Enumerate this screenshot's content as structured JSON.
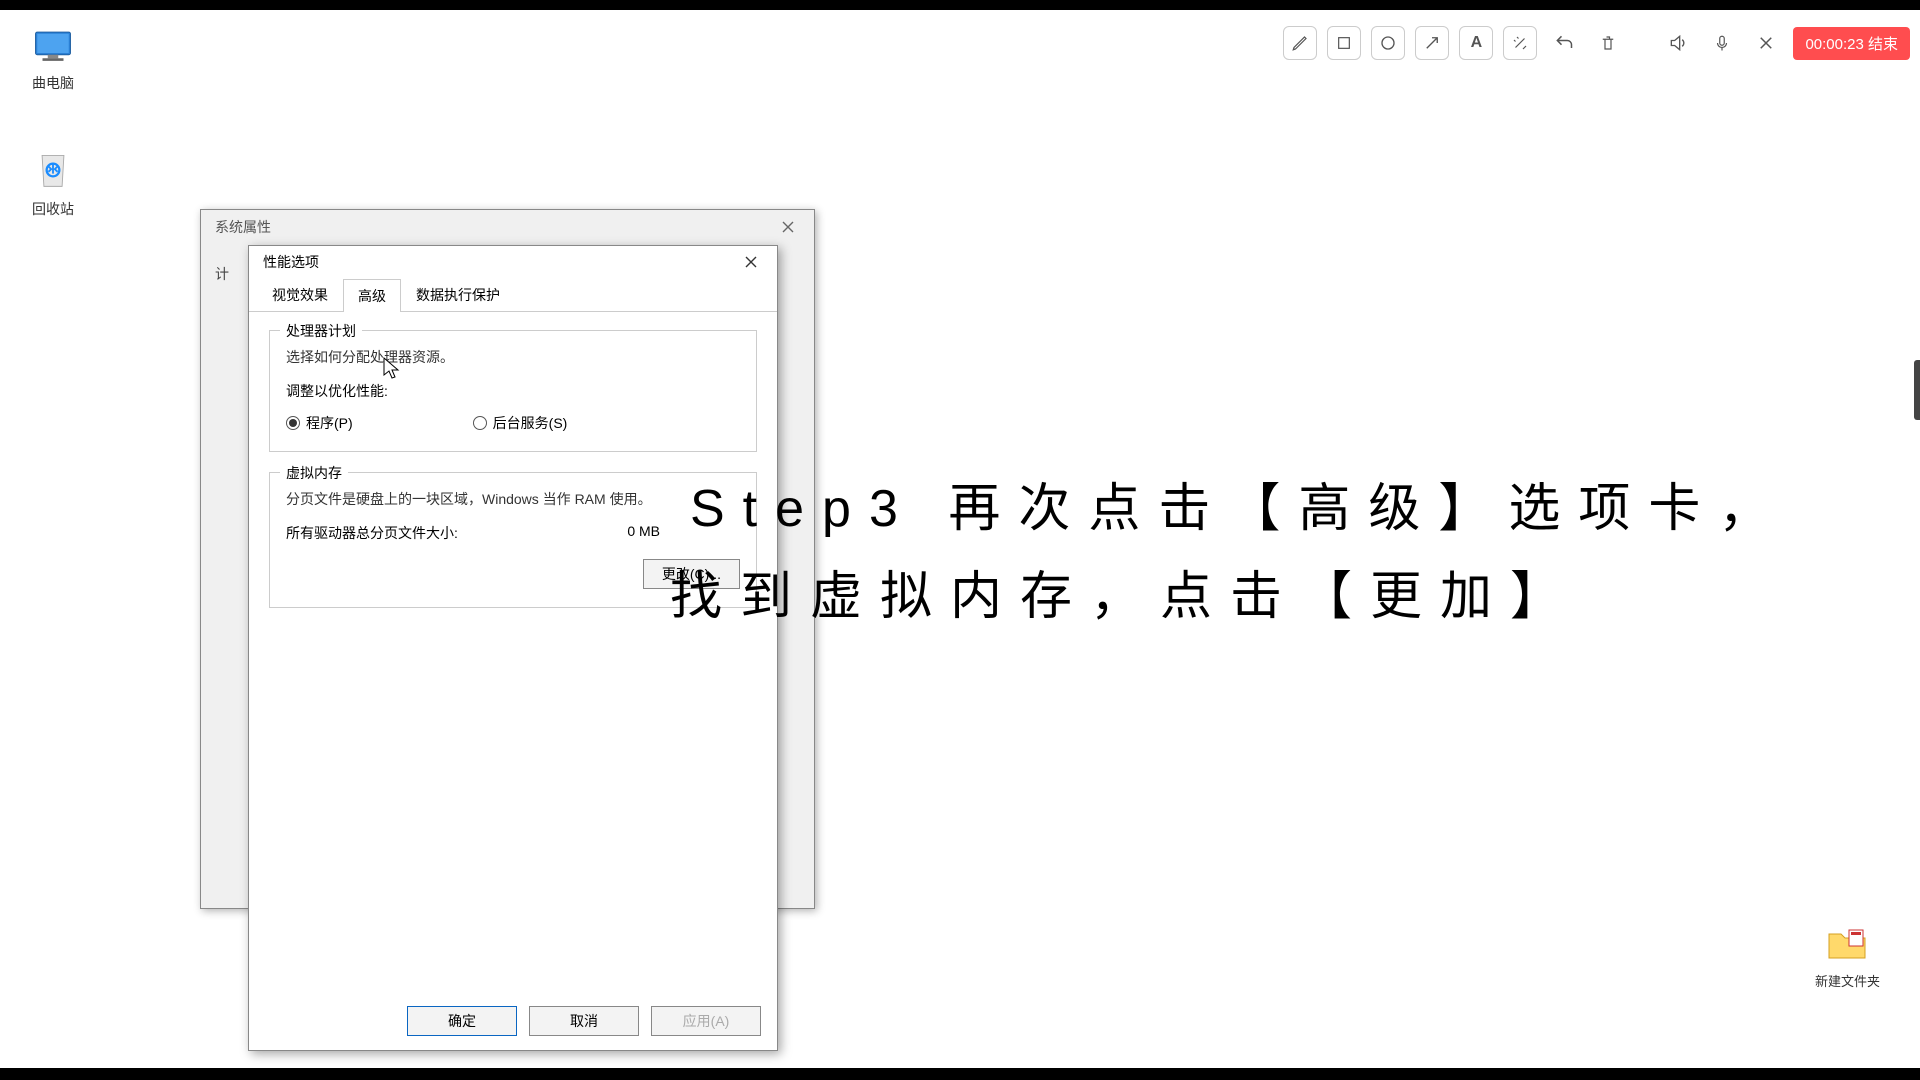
{
  "desktop": {
    "computer": "曲电脑",
    "recycle": "回收站",
    "newfolder": "新建文件夹"
  },
  "toolbar": {
    "record_time": "00:00:23 结束"
  },
  "dialog1": {
    "title": "系统属性",
    "tab_fragment": "计"
  },
  "dialog2": {
    "title": "性能选项",
    "tabs": {
      "visual": "视觉效果",
      "advanced": "高级",
      "dep": "数据执行保护"
    },
    "cpu": {
      "legend": "处理器计划",
      "desc": "选择如何分配处理器资源。",
      "adjust": "调整以优化性能:",
      "programs": "程序(P)",
      "services": "后台服务(S)"
    },
    "vm": {
      "legend": "虚拟内存",
      "desc": "分页文件是硬盘上的一块区域，Windows 当作 RAM 使用。",
      "total_label": "所有驱动器总分页文件大小:",
      "total_value": "0 MB",
      "change": "更改(C)..."
    },
    "buttons": {
      "ok": "确定",
      "cancel": "取消",
      "apply": "应用(A)"
    }
  },
  "annotation": {
    "line1": "Step3 再次点击【高级】选项卡，",
    "line2": "找到虚拟内存，点击【更加】"
  }
}
